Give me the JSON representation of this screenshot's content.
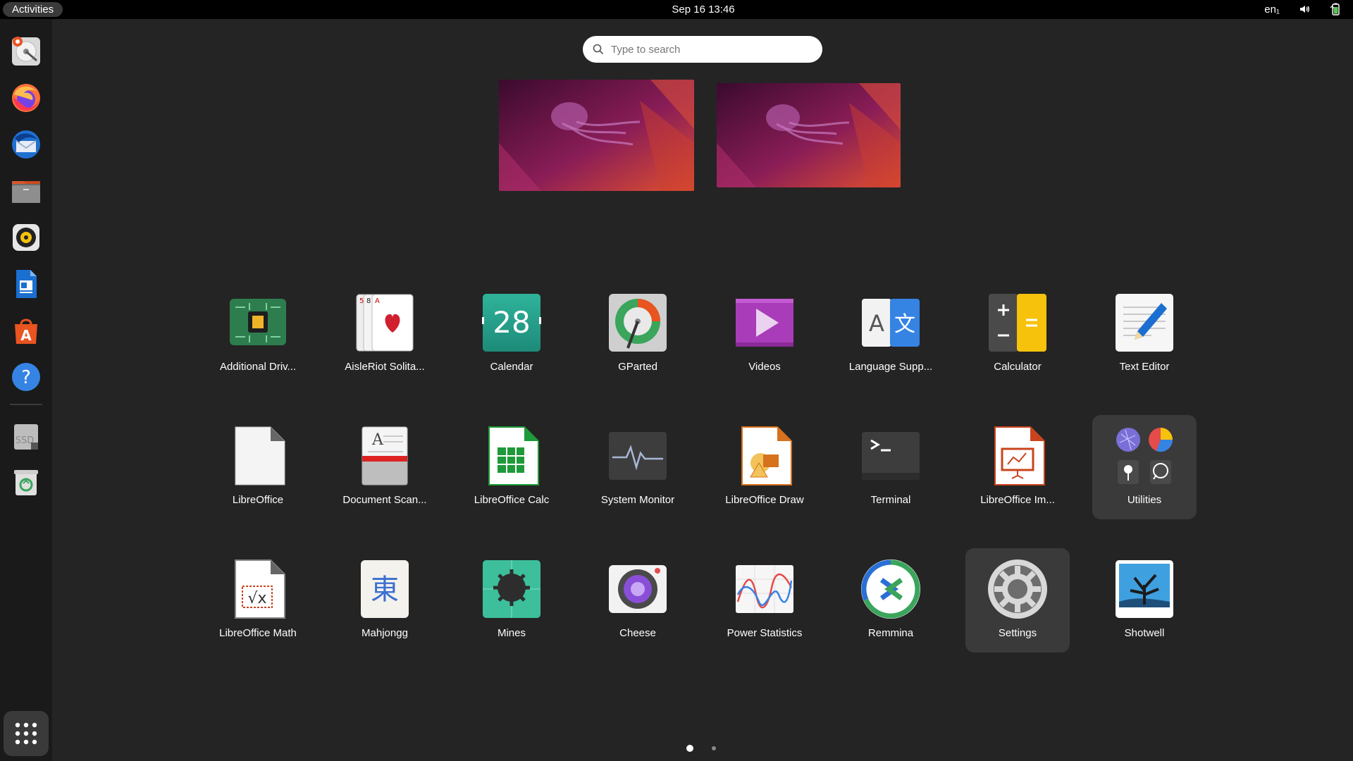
{
  "topbar": {
    "activities": "Activities",
    "clock": "Sep 16  13:46",
    "keyboard_layout": "en₁",
    "icons": [
      "volume-icon",
      "battery-icon"
    ]
  },
  "dock": {
    "items": [
      {
        "name": "disk-installer",
        "icon": "installer-icon"
      },
      {
        "name": "firefox",
        "icon": "firefox-icon"
      },
      {
        "name": "thunderbird",
        "icon": "thunderbird-icon"
      },
      {
        "name": "files",
        "icon": "files-icon"
      },
      {
        "name": "rhythmbox",
        "icon": "rhythmbox-icon"
      },
      {
        "name": "libreoffice-writer",
        "icon": "writer-icon"
      },
      {
        "name": "app-center",
        "icon": "app-center-icon"
      },
      {
        "name": "help",
        "icon": "help-icon"
      },
      {
        "name": "ssd-drive",
        "icon": "drive-icon",
        "text": "SSD"
      },
      {
        "name": "trash",
        "icon": "trash-icon"
      }
    ],
    "show_apps": "show-apps-icon"
  },
  "search": {
    "placeholder": "Type to search",
    "value": ""
  },
  "apps": [
    "Additional Driv...",
    "AisleRiot Solita...",
    "Calendar",
    "GParted",
    "Videos",
    "Language Supp...",
    "Calculator",
    "Text Editor",
    "LibreOffice",
    "Document Scan...",
    "LibreOffice Calc",
    "System Monitor",
    "LibreOffice Draw",
    "Terminal",
    "LibreOffice Im...",
    "Utilities",
    "LibreOffice Math",
    "Mahjongg",
    "Mines",
    "Cheese",
    "Power Statistics",
    "Remmina",
    "Settings",
    "Shotwell"
  ],
  "calendar_day": "28",
  "pagination": {
    "current": 1,
    "total": 2
  },
  "colors": {
    "accent": "#e95420",
    "background": "#242424",
    "dock": "#1a1a1a",
    "highlight": "#3a3a3a"
  }
}
